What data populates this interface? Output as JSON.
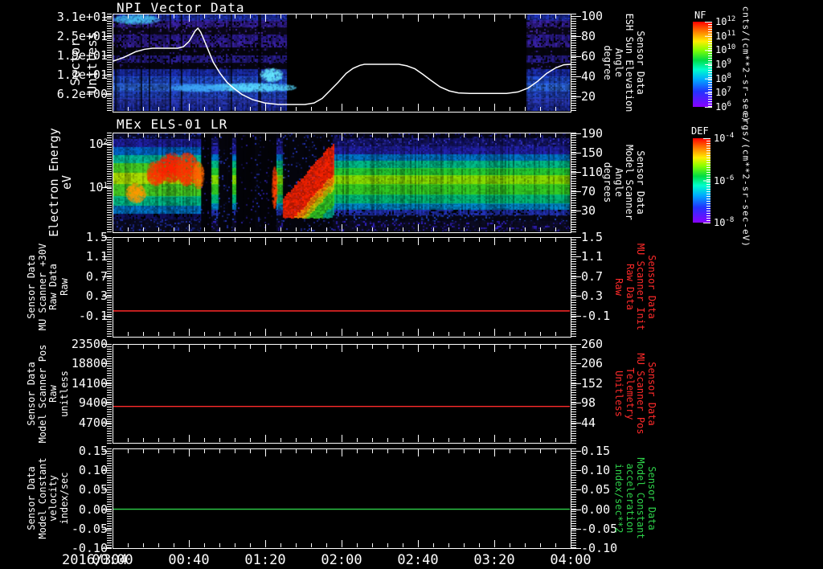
{
  "figure": {
    "background": "#000000",
    "text_color": "#ffffff"
  },
  "x_axis": {
    "date_label": "2016/304",
    "tick_labels": [
      "00:00",
      "00:40",
      "01:20",
      "02:00",
      "02:40",
      "03:20",
      "04:00"
    ]
  },
  "panels": [
    {
      "title": "NPI Vector Data",
      "left_axis": {
        "label_lines": [
          "Sector",
          "Unitless"
        ],
        "tick_labels": [
          "3.1e+01",
          "2.5e+01",
          "1.9e+01",
          "1.2e+01",
          "6.2e+00"
        ]
      },
      "right_axis": {
        "label_lines": [
          "Sensor Data",
          "ESH Sun Elevation",
          "Angle",
          "degree"
        ],
        "tick_labels": [
          "100",
          "80",
          "60",
          "40",
          "20"
        ],
        "color": "#ffffff"
      }
    },
    {
      "title": "MEx ELS-01 LR",
      "left_axis": {
        "label_lines": [
          "Electron Energy",
          "eV"
        ],
        "tick_labels_exp": [
          [
            "10",
            "2"
          ],
          [
            "10",
            "1"
          ]
        ]
      },
      "right_axis": {
        "label_lines": [
          "Sensor Data",
          "Model Scanner",
          "Angle",
          "degrees"
        ],
        "tick_labels": [
          "190",
          "150",
          "110",
          "70",
          "30"
        ],
        "color": "#ffffff"
      }
    },
    {
      "title": "",
      "left_axis": {
        "label_lines": [
          "Sensor Data",
          "MU Scanner +30V",
          "Raw Data",
          "Raw"
        ],
        "tick_labels": [
          "1.5",
          "1.1",
          "0.7",
          "0.3",
          "-0.1"
        ]
      },
      "right_axis": {
        "label_lines": [
          "Sensor Data",
          "MU Scanner Init",
          "Raw Data",
          "Raw"
        ],
        "tick_labels": [
          "1.5",
          "1.1",
          "0.7",
          "0.3",
          "-0.1"
        ],
        "color": "#ff2a2a"
      }
    },
    {
      "title": "",
      "left_axis": {
        "label_lines": [
          "Sensor Data",
          "Model Scanner Pos",
          "Raw",
          "unitless"
        ],
        "tick_labels": [
          "23500",
          "18800",
          "14100",
          "9400",
          "4700"
        ]
      },
      "right_axis": {
        "label_lines": [
          "Sensor Data",
          "MU Scanner Pos",
          "Telemetry",
          "Unitless"
        ],
        "tick_labels": [
          "260",
          "206",
          "152",
          "98",
          "44"
        ],
        "color": "#ff2a2a"
      }
    },
    {
      "title": "",
      "left_axis": {
        "label_lines": [
          "Sensor Data",
          "Model Constant",
          "velocity",
          "index/sec"
        ],
        "tick_labels": [
          "0.15",
          "0.10",
          "0.05",
          "0.00",
          "-0.05",
          "-0.10"
        ]
      },
      "right_axis": {
        "label_lines": [
          "Sensor Data",
          "Model Constant",
          "acceleration",
          "index/sec**2"
        ],
        "tick_labels": [
          "0.15",
          "0.10",
          "0.05",
          "0.00",
          "-0.05",
          "-0.10"
        ],
        "color": "#2ed24a"
      }
    }
  ],
  "colorbars": [
    {
      "name": "NF",
      "units": "cnts/(cm**2-sr-sec)",
      "tick_labels_exp": [
        [
          "10",
          "12"
        ],
        [
          "10",
          "11"
        ],
        [
          "10",
          "10"
        ],
        [
          "10",
          "9"
        ],
        [
          "10",
          "8"
        ],
        [
          "10",
          "7"
        ],
        [
          "10",
          "6"
        ]
      ]
    },
    {
      "name": "DEF",
      "units": "ergs/(cm**2-sr-sec-eV)",
      "tick_labels_exp": [
        [
          "10",
          "-4"
        ],
        [
          "10",
          "-6"
        ],
        [
          "10",
          "-8"
        ]
      ]
    }
  ],
  "chart_data": [
    {
      "type": "heatmap",
      "panel": 1,
      "title": "NPI Vector Data",
      "ylabel": "Sector (Unitless)",
      "y_ticks": [
        31,
        25,
        19,
        12,
        6.2
      ],
      "time_range_hours": [
        0,
        4
      ],
      "colorbar": "NF",
      "colorbar_units": "cnts/(cm**2-sr-sec)",
      "colorbar_decade_range": [
        6,
        12
      ],
      "data_present_hours": [
        [
          0.0,
          1.52
        ],
        [
          3.62,
          4.0
        ]
      ],
      "overlay_series": {
        "name": "ESH Sun Elevation Angle",
        "units": "degree",
        "axis_ticks": [
          100,
          80,
          60,
          40,
          20
        ],
        "color": "#ffffff",
        "points_hours_degrees": [
          [
            0,
            55
          ],
          [
            0.1,
            59
          ],
          [
            0.2,
            64.5
          ],
          [
            0.28,
            67
          ],
          [
            0.35,
            68
          ],
          [
            0.57,
            68
          ],
          [
            0.62,
            69.5
          ],
          [
            0.67,
            75
          ],
          [
            0.72,
            85
          ],
          [
            0.745,
            88
          ],
          [
            0.77,
            84
          ],
          [
            0.8,
            76
          ],
          [
            0.84,
            65
          ],
          [
            0.88,
            54
          ],
          [
            0.94,
            43
          ],
          [
            1.0,
            34
          ],
          [
            1.06,
            28
          ],
          [
            1.13,
            22
          ],
          [
            1.22,
            17
          ],
          [
            1.33,
            13.5
          ],
          [
            1.45,
            12
          ],
          [
            1.68,
            12
          ],
          [
            1.76,
            13.5
          ],
          [
            1.83,
            18
          ],
          [
            1.9,
            26
          ],
          [
            1.97,
            34
          ],
          [
            2.04,
            43
          ],
          [
            2.1,
            48
          ],
          [
            2.16,
            51
          ],
          [
            2.2,
            52
          ],
          [
            2.5,
            52
          ],
          [
            2.57,
            50.5
          ],
          [
            2.64,
            47.5
          ],
          [
            2.71,
            42
          ],
          [
            2.78,
            36
          ],
          [
            2.86,
            29.5
          ],
          [
            2.94,
            25.5
          ],
          [
            3.02,
            23.5
          ],
          [
            3.12,
            23
          ],
          [
            3.44,
            23
          ],
          [
            3.54,
            24.5
          ],
          [
            3.63,
            28.5
          ],
          [
            3.71,
            35
          ],
          [
            3.79,
            43
          ],
          [
            3.87,
            48.5
          ],
          [
            3.94,
            51.5
          ],
          [
            4.0,
            52
          ]
        ]
      },
      "texture": {
        "sets": {
          "A": [
            [
              0.0,
              0.06,
              "#2238c8",
              0.55,
              null,
              0
            ],
            [
              0.06,
              0.13,
              "#3a22aa",
              0.55,
              "#000000",
              0.15
            ],
            [
              0.13,
              0.205,
              "#0a0618",
              0.2,
              "#4428aa",
              0.18
            ],
            [
              0.205,
              0.275,
              "#2f1d9e",
              0.5,
              "#000000",
              0.12
            ],
            [
              0.275,
              0.345,
              "#3b23ae",
              0.5,
              "#000000",
              0.25
            ],
            [
              0.345,
              0.425,
              "#05040e",
              0.1,
              "#34209a",
              0.1
            ],
            [
              0.425,
              0.5,
              "#2c209c",
              0.5,
              "#000000",
              0.2
            ],
            [
              0.5,
              0.57,
              "#070510",
              0.1,
              "#301d92",
              0.12
            ],
            [
              0.57,
              0.64,
              "#1b2fb6",
              0.5,
              null,
              0
            ],
            [
              0.64,
              0.715,
              "#2350d8",
              0.5,
              null,
              0
            ],
            [
              0.715,
              0.79,
              "#2f6ce8",
              0.5,
              null,
              0
            ],
            [
              0.79,
              0.865,
              "#2346cc",
              0.5,
              null,
              0
            ],
            [
              0.865,
              0.93,
              "#2a3abc",
              0.5,
              null,
              0
            ],
            [
              0.93,
              1.0,
              "#2030b0",
              0.5,
              null,
              0
            ]
          ]
        },
        "segments": [
          {
            "x0": 0.0,
            "x1": 0.379,
            "set": "A"
          },
          {
            "x0": 0.905,
            "x1": 1.0,
            "set": "A"
          }
        ],
        "blobs": [
          {
            "cx": 0.3,
            "cy": 0.75,
            "rx": 0.1,
            "ry": 0.045,
            "c": "#58d8ff"
          },
          {
            "cx": 0.185,
            "cy": 0.755,
            "rx": 0.06,
            "ry": 0.04,
            "c": "#3fa8f8"
          },
          {
            "cx": 0.05,
            "cy": 0.045,
            "rx": 0.05,
            "ry": 0.05,
            "c": "#44bbee"
          },
          {
            "cx": 0.345,
            "cy": 0.62,
            "rx": 0.025,
            "ry": 0.07,
            "c": "#66e8ff"
          }
        ],
        "col_dropout": 0.06
      }
    },
    {
      "type": "heatmap",
      "panel": 2,
      "title": "MEx ELS-01 LR",
      "ylabel": "Electron Energy (eV)",
      "yscale": "log",
      "y_ticks": [
        100,
        10
      ],
      "right_axis_series": {
        "name": "Model Scanner Angle",
        "units": "degrees",
        "ticks": [
          190,
          150,
          110,
          70,
          30
        ]
      },
      "colorbar": "DEF",
      "colorbar_units": "ergs/(cm**2-sr-sec-eV)",
      "colorbar_decade_range": [
        -8,
        -4
      ],
      "features": [
        "intense 20-100 eV electron flux burst 00:20-00:45",
        "data dropouts ~00:46-01:26",
        "rising intense flux wedge 01:30-02:00",
        "steady 5-40 eV green band 02:00-04:00"
      ],
      "texture": {
        "sets": {
          "steady": [
            [
              0.0,
              0.05,
              "#05051a",
              0.3,
              "#2020a0",
              0.25
            ],
            [
              0.05,
              0.13,
              "#131370",
              0.5,
              "#3333cc",
              0.3
            ],
            [
              0.13,
              0.21,
              "#2222b0",
              0.5,
              null,
              0
            ],
            [
              0.21,
              0.28,
              "#0077cc",
              0.4,
              null,
              0
            ],
            [
              0.28,
              0.35,
              "#00bb88",
              0.35,
              null,
              0
            ],
            [
              0.35,
              0.43,
              "#22cc33",
              0.3,
              null,
              0
            ],
            [
              0.43,
              0.52,
              "#88dd00",
              0.3,
              null,
              0
            ],
            [
              0.52,
              0.62,
              "#33cc22",
              0.3,
              null,
              0
            ],
            [
              0.62,
              0.71,
              "#00bb77",
              0.35,
              null,
              0
            ],
            [
              0.71,
              0.78,
              "#0088cc",
              0.45,
              null,
              0
            ],
            [
              0.78,
              0.84,
              "#2233bb",
              0.5,
              "#000000",
              0.2
            ],
            [
              0.84,
              0.89,
              "#070718",
              0.2,
              "#2244cc",
              0.15
            ],
            [
              0.89,
              1.0,
              "#0b0b22",
              0.4,
              "#3322cc",
              0.25
            ]
          ],
          "active": [
            [
              0.0,
              0.06,
              "#0a0a30",
              0.4,
              "#2233aa",
              0.3
            ],
            [
              0.06,
              0.14,
              "#2020a8",
              0.5,
              null,
              0
            ],
            [
              0.14,
              0.22,
              "#0066cc",
              0.4,
              null,
              0
            ],
            [
              0.22,
              0.3,
              "#00bb99",
              0.35,
              null,
              0
            ],
            [
              0.3,
              0.4,
              "#44cc22",
              0.3,
              null,
              0
            ],
            [
              0.4,
              0.52,
              "#aadd00",
              0.3,
              null,
              0
            ],
            [
              0.52,
              0.64,
              "#44cc22",
              0.3,
              null,
              0
            ],
            [
              0.64,
              0.74,
              "#00bb88",
              0.35,
              null,
              0
            ],
            [
              0.74,
              0.82,
              "#0077cc",
              0.45,
              null,
              0
            ],
            [
              0.82,
              0.88,
              "#111166",
              0.4,
              "#000000",
              0.2
            ],
            [
              0.88,
              1.0,
              "#0a0a20",
              0.4,
              "#2233bb",
              0.25
            ]
          ],
          "gap": [
            [
              0.0,
              1.0,
              "#020208",
              0.1,
              "#2a1f9e",
              0.05
            ]
          ],
          "gapS": [
            [
              0.0,
              1.0,
              "#04040c",
              0.15,
              "#2433b4",
              0.12
            ]
          ]
        },
        "segments": [
          {
            "x0": 0.0,
            "x1": 0.193,
            "set": "active"
          },
          {
            "x0": 0.193,
            "x1": 0.216,
            "set": "gap"
          },
          {
            "x0": 0.216,
            "x1": 0.232,
            "set": "steady"
          },
          {
            "x0": 0.232,
            "x1": 0.262,
            "set": "gapS"
          },
          {
            "x0": 0.262,
            "x1": 0.27,
            "set": "steady"
          },
          {
            "x0": 0.27,
            "x1": 0.31,
            "set": "gap"
          },
          {
            "x0": 0.31,
            "x1": 0.322,
            "set": "gapS"
          },
          {
            "x0": 0.322,
            "x1": 0.358,
            "set": "gap"
          },
          {
            "x0": 0.358,
            "x1": 0.372,
            "set": "steady"
          },
          {
            "x0": 0.372,
            "x1": 0.482,
            "set": "gapS"
          },
          {
            "x0": 0.482,
            "x1": 1.0,
            "set": "steady"
          }
        ],
        "blobs": [
          {
            "cx": 0.048,
            "cy": 0.6,
            "rx": 0.022,
            "ry": 0.1,
            "c": "#ff9900"
          },
          {
            "cx": 0.092,
            "cy": 0.4,
            "rx": 0.02,
            "ry": 0.13,
            "c": "#ff3300"
          },
          {
            "cx": 0.125,
            "cy": 0.34,
            "rx": 0.028,
            "ry": 0.15,
            "c": "#ff2200"
          },
          {
            "cx": 0.16,
            "cy": 0.36,
            "rx": 0.025,
            "ry": 0.17,
            "c": "#ff3300"
          },
          {
            "cx": 0.185,
            "cy": 0.42,
            "rx": 0.012,
            "ry": 0.14,
            "c": "#ff6600"
          },
          {
            "cx": 0.352,
            "cy": 0.55,
            "rx": 0.006,
            "ry": 0.22,
            "c": "#ff4400"
          }
        ],
        "wedge": {
          "x0": 0.372,
          "x1": 0.482,
          "ftop0": 0.66,
          "ftop1": 0.09,
          "stack": [
            [
              "#ff2200",
              0.32
            ],
            [
              "#ff8800",
              0.08
            ],
            [
              "#cccc00",
              0.07
            ],
            [
              "#33cc22",
              0.16
            ],
            [
              "#00aa88",
              0.1
            ]
          ]
        },
        "col_dropout": 0.0
      }
    },
    {
      "type": "line",
      "panel": 3,
      "series": "MU Scanner +30V Raw Data (Raw)",
      "constant_value": 0.0,
      "axis_range": [
        -0.1,
        1.5
      ],
      "color": "#ff2a2a"
    },
    {
      "type": "line",
      "panel": 4,
      "series": "Model Scanner Pos Raw (unitless)",
      "constant_value": 8600,
      "axis_range": [
        4700,
        23500
      ],
      "color": "#ff2a2a"
    },
    {
      "type": "line",
      "panel": 5,
      "series": "Model Constant velocity (index/sec)",
      "constant_value": 0.0,
      "axis_range": [
        -0.1,
        0.15
      ],
      "color": "#2ed24a"
    }
  ]
}
